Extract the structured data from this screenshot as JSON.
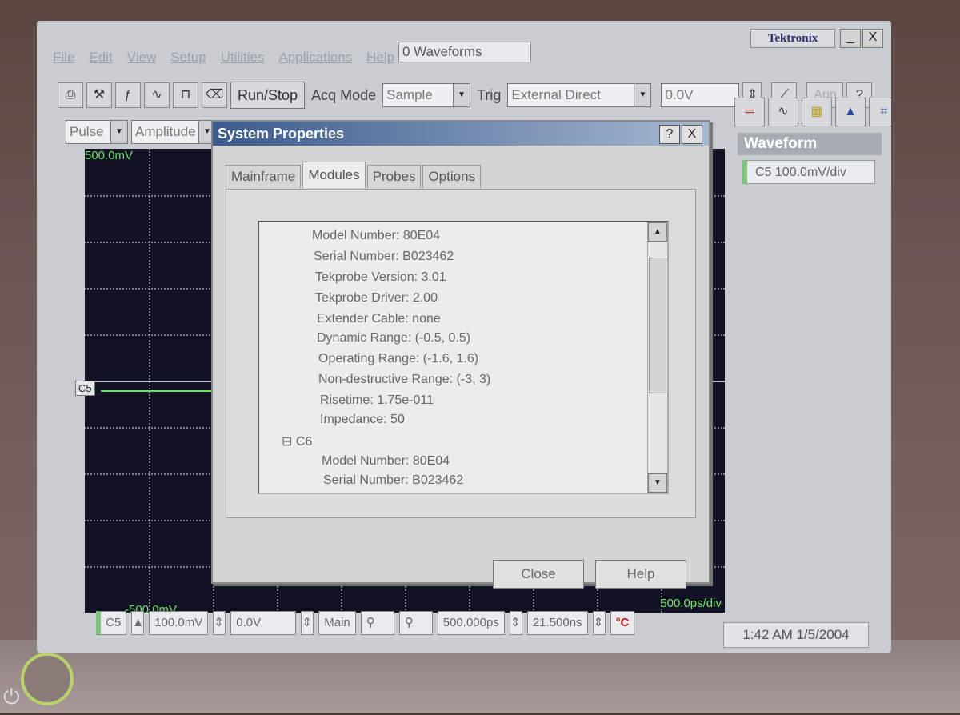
{
  "window": {
    "brand": "Tektronix",
    "minimize": "_",
    "close": "X"
  },
  "menu": {
    "items": [
      "File",
      "Edit",
      "View",
      "Setup",
      "Utilities",
      "Applications",
      "Help"
    ],
    "waveforms_box": "0 Waveforms"
  },
  "toolbar": {
    "runstop": "Run/Stop",
    "acq_mode_label": "Acq Mode",
    "acq_mode_value": "Sample",
    "trig_label": "Trig",
    "trig_value": "External Direct",
    "level_value": "0.0V",
    "app_label": "App",
    "help_label": "?"
  },
  "toolbar2": {
    "measure_type": "Pulse",
    "measure_value": "Amplitude"
  },
  "right_panel": {
    "title": "Waveform",
    "channel": "C5 100.0mV/div"
  },
  "scope": {
    "top_label": "500.0mV",
    "bottom_label": "-500.0mV",
    "timebase_label": "500.0ps/div",
    "channel_marker": "C5"
  },
  "dialog": {
    "title": "System Properties",
    "help_btn": "?",
    "close_x": "X",
    "tabs": [
      "Mainframe",
      "Modules",
      "Probes",
      "Options"
    ],
    "active_tab": "Modules",
    "tree": [
      "Model Number: 80E04",
      "Serial Number: B023462",
      "Tekprobe Version: 3.01",
      "Tekprobe Driver: 2.00",
      "Extender Cable: none",
      "Dynamic Range: (-0.5, 0.5)",
      "Operating Range: (-1.6, 1.6)",
      "Non-destructive Range: (-3, 3)",
      "Risetime: 1.75e-011",
      "Impedance: 50",
      "C6",
      "Model Number: 80E04",
      "Serial Number: B023462"
    ],
    "close_button": "Close",
    "help_button": "Help"
  },
  "statusbar": {
    "channel": "C5",
    "vdiv": "100.0mV",
    "offset": "0.0V",
    "main": "Main",
    "horiz_scale": "500.000ps",
    "horiz_pos": "21.500ns",
    "temp": "°C",
    "datetime": "1:42 AM 1/5/2004"
  }
}
